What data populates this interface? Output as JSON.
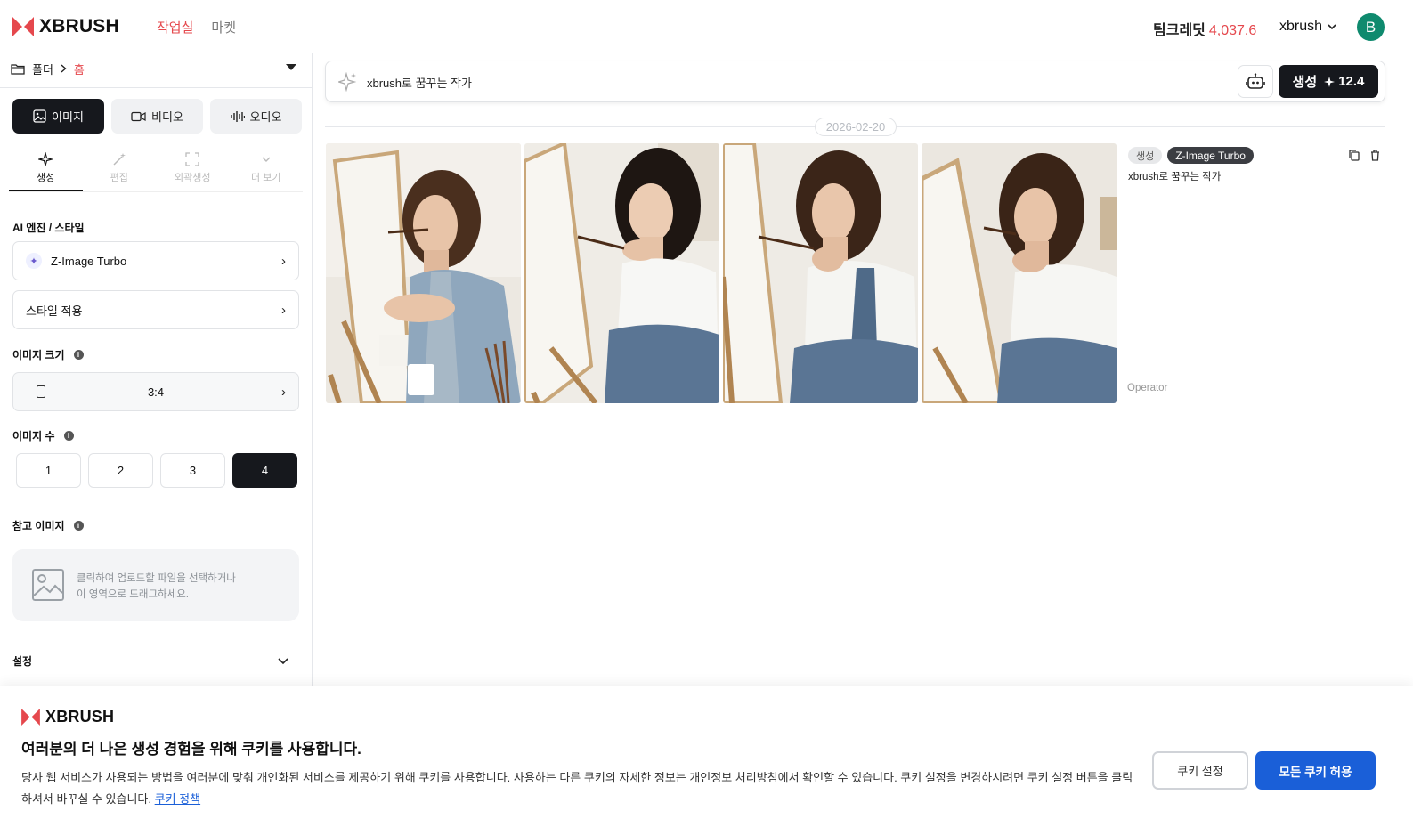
{
  "brand": {
    "name": "XBRUSH",
    "accent": "#e5484d",
    "primary_blue": "#1a5fd8",
    "dark": "#16181d"
  },
  "nav": {
    "items": [
      {
        "label": "작업실",
        "active": true
      },
      {
        "label": "마켓",
        "active": false
      }
    ]
  },
  "header": {
    "credits_label": "팀크레딧",
    "credits_value": "4,037.6",
    "user_name": "xbrush",
    "avatar_initial": "B"
  },
  "sidebar": {
    "breadcrumb": {
      "folder_label": "폴더",
      "current": "홈"
    },
    "media_tabs": [
      {
        "label": "이미지",
        "icon": "image-icon",
        "active": true
      },
      {
        "label": "비디오",
        "icon": "video-icon",
        "active": false
      },
      {
        "label": "오디오",
        "icon": "audio-wave-icon",
        "active": false
      }
    ],
    "sub_tabs": [
      {
        "label": "생성",
        "icon": "sparkle-icon",
        "active": true
      },
      {
        "label": "편집",
        "icon": "magic-wand-icon",
        "active": false
      },
      {
        "label": "외곽생성",
        "icon": "expand-icon",
        "active": false
      },
      {
        "label": "더 보기",
        "icon": "chevron-down-icon",
        "active": false
      }
    ],
    "engine_section": {
      "label": "AI 엔진 / 스타일",
      "engine": "Z-Image Turbo",
      "style": "스타일 적용"
    },
    "size_section": {
      "label": "이미지 크기",
      "ratio": "3:4"
    },
    "count_section": {
      "label": "이미지 수",
      "options": [
        "1",
        "2",
        "3",
        "4"
      ],
      "selected": "4"
    },
    "reference_section": {
      "label": "참고 이미지",
      "upload_line1": "클릭하여 업로드할 파일을 선택하거나",
      "upload_line2": "이 영역으로 드래그하세요."
    },
    "settings_label": "설정"
  },
  "main": {
    "prompt": {
      "value": "xbrush로 꿈꾸는 작가",
      "generate_label": "생성",
      "generate_cost": "12.4"
    },
    "date": "2026-02-20",
    "result": {
      "tag_type": "생성",
      "tag_engine": "Z-Image Turbo",
      "prompt_text": "xbrush로 꿈꾸는 작가",
      "author": "Operator",
      "image_count": 4
    }
  },
  "cookie_banner": {
    "title": "여러분의 더 나은 생성 경험을 위해 쿠키를 사용합니다.",
    "body": "당사 웹 서비스가 사용되는 방법을 여러분에 맞춰 개인화된 서비스를 제공하기 위해 쿠키를 사용합니다. 사용하는 다른 쿠키의 자세한 정보는 개인정보 처리방침에서 확인할 수 있습니다. 쿠키 설정을 변경하시려면 쿠키 설정 버튼을 클릭하셔서 바꾸실 수 있습니다.",
    "policy_link": "쿠키 정책",
    "settings_button": "쿠키 설정",
    "accept_button": "모든 쿠키 허용"
  }
}
